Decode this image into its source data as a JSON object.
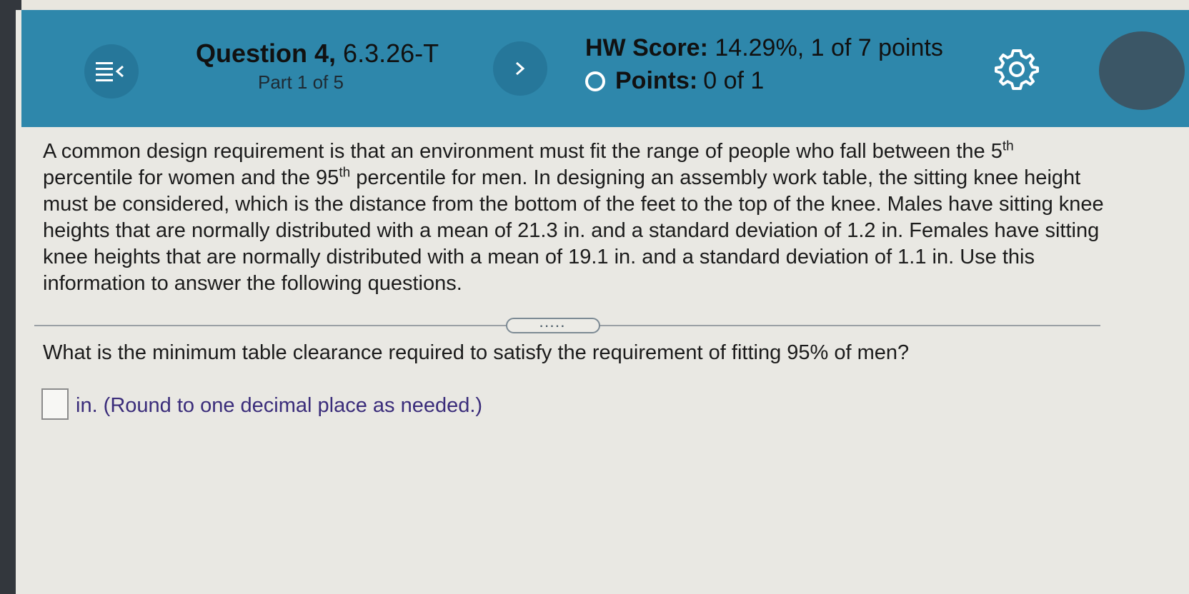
{
  "header": {
    "question_label": "Question 4,",
    "question_code": "6.3.26-T",
    "part": "Part 1 of 5",
    "hw_score_label": "HW Score:",
    "hw_score_value": "14.29%, 1 of 7 points",
    "points_label": "Points:",
    "points_value": "0 of 1",
    "next_label": ">",
    "menu_icon": "menu-collapse-icon",
    "settings_icon": "gear-icon"
  },
  "problem": {
    "text_part1": "A common design requirement is that an environment must fit the range of people who fall between the 5",
    "sup1": "th",
    "text_part2": " percentile for women and the 95",
    "sup2": "th",
    "text_part3": " percentile for men. In designing an assembly work table, the sitting knee height must be considered, which is the distance from the bottom of the feet to the top of the knee. Males have sitting knee heights that are normally distributed with a mean of 21.3 in. and a standard deviation of 1.2 in. Females have sitting knee heights that are normally distributed with a mean of 19.1 in. and a standard deviation of 1.1 in. Use this information to answer the following questions."
  },
  "divider_dots": ".....",
  "question": {
    "text": "What is the minimum table clearance required to satisfy the requirement of fitting 95% of men?",
    "answer_value": "",
    "answer_hint": "in. (Round to one decimal place as needed.)"
  },
  "colors": {
    "header_bg": "#2e87ab",
    "button_bg": "#26779a",
    "hint_text": "#3a2c7a"
  }
}
